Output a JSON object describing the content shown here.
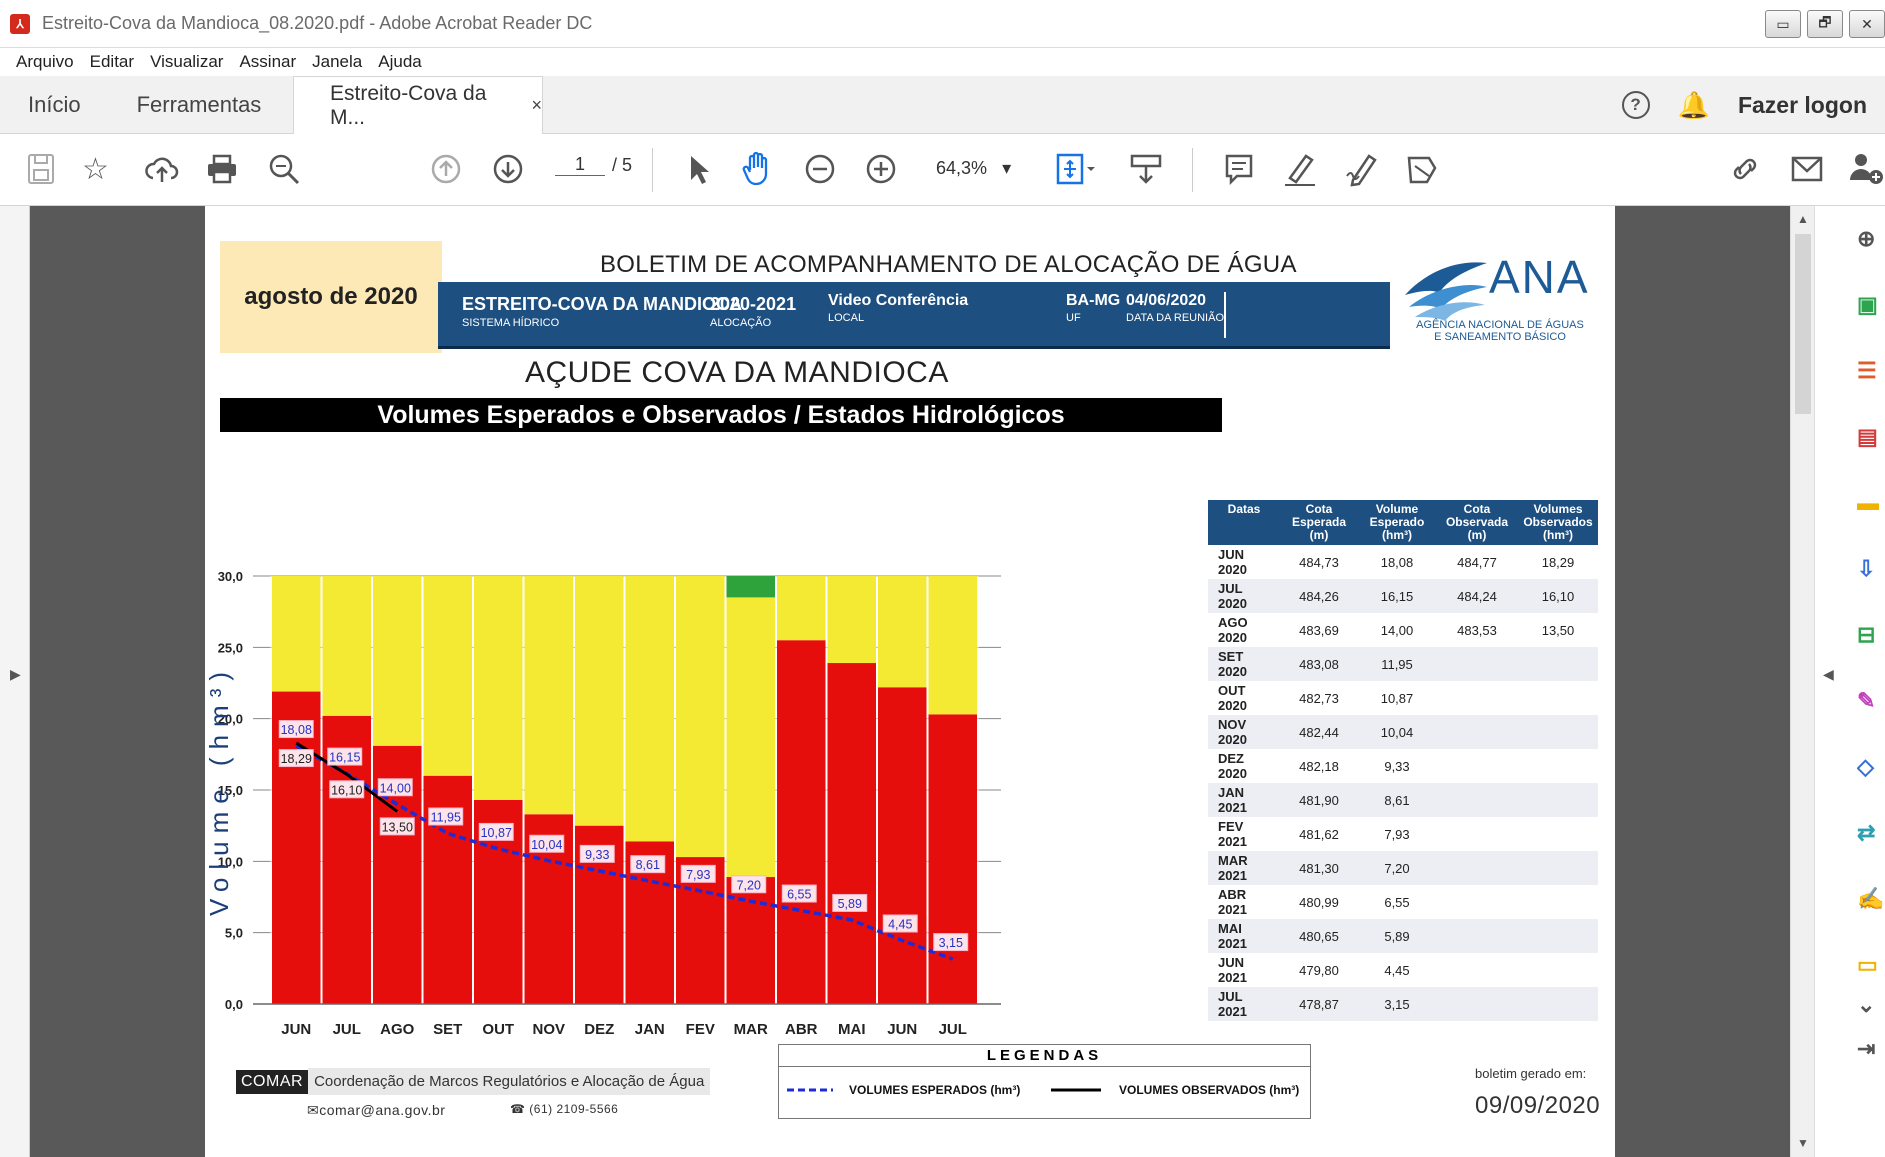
{
  "window": {
    "title": "Estreito-Cova da Mandioca_08.2020.pdf - Adobe Acrobat Reader DC",
    "buttons": [
      "▭",
      "🗗",
      "✕"
    ]
  },
  "menu": [
    "Arquivo",
    "Editar",
    "Visualizar",
    "Assinar",
    "Janela",
    "Ajuda"
  ],
  "tabs": {
    "home": "Início",
    "tools": "Ferramentas",
    "document": "Estreito-Cova da M...",
    "close": "×",
    "help": "?",
    "login": "Fazer logon"
  },
  "toolbar": {
    "page_current": "1",
    "page_total": "/ 5",
    "zoom": "64,3%",
    "icons": [
      "save-icon",
      "star-icon",
      "upload-icon",
      "print-icon",
      "search-zoom-icon",
      "page-up-icon",
      "page-down-icon",
      "pointer-icon",
      "hand-icon",
      "zoom-out-icon",
      "zoom-in-icon",
      "fit-page-icon",
      "scroll-mode-icon",
      "comment-icon",
      "highlight-icon",
      "sign-icon",
      "stamp-icon",
      "link-icon",
      "email-icon",
      "add-user-icon"
    ]
  },
  "right_panel": {
    "icons": [
      "zoom-icon",
      "export-pdf-icon",
      "organize-pages-icon",
      "create-pdf-icon",
      "comment-icon",
      "export-icon",
      "compress-icon",
      "fill-sign-icon",
      "protect-icon",
      "send-icon",
      "signature-icon",
      "more-tools-icon",
      "expand-icon",
      "collapse-panel-icon"
    ],
    "colors": [
      "#1a8ccc",
      "#2da44e",
      "#e05a2b",
      "#d43a3a",
      "#f0b400",
      "#3a6fd8",
      "#2da44e",
      "#c23fbe",
      "#3a6fd8",
      "#2aa0b0",
      "#c23fbe",
      "#f0b400"
    ]
  },
  "document": {
    "month_label": "agosto de 2020",
    "report_title": "BOLETIM DE ACOMPANHAMENTO DE ALOCAÇÃO DE ÁGUA",
    "header_fields": [
      {
        "value": "ESTREITO-COVA DA MANDIOCA",
        "label": "SISTEMA HÍDRICO"
      },
      {
        "value": "2020-2021",
        "label": "ALOCAÇÃO"
      },
      {
        "value": "Video Conferência",
        "label": "LOCAL"
      },
      {
        "value": "BA-MG",
        "label": "UF"
      },
      {
        "value": "04/06/2020",
        "label": "DATA DA REUNIÃO"
      }
    ],
    "agency": {
      "name": "ANA",
      "subtitle_line1": "AGÊNCIA NACIONAL DE ÁGUAS",
      "subtitle_line2": "E SANEAMENTO BÁSICO"
    },
    "reservoir_title": "AÇUDE COVA DA MANDIOCA",
    "chart_header": "Volumes Esperados e Observados / Estados Hidrológicos",
    "table": {
      "headers": [
        "Datas",
        "Cota Esperada (m)",
        "Volume Esperado (hm³)",
        "Cota Observada (m)",
        "Volumes Observados (hm³)"
      ],
      "rows": [
        [
          "JUN 2020",
          "484,73",
          "18,08",
          "484,77",
          "18,29"
        ],
        [
          "JUL 2020",
          "484,26",
          "16,15",
          "484,24",
          "16,10"
        ],
        [
          "AGO 2020",
          "483,69",
          "14,00",
          "483,53",
          "13,50"
        ],
        [
          "SET 2020",
          "483,08",
          "11,95",
          "",
          ""
        ],
        [
          "OUT 2020",
          "482,73",
          "10,87",
          "",
          ""
        ],
        [
          "NOV 2020",
          "482,44",
          "10,04",
          "",
          ""
        ],
        [
          "DEZ 2020",
          "482,18",
          "9,33",
          "",
          ""
        ],
        [
          "JAN 2021",
          "481,90",
          "8,61",
          "",
          ""
        ],
        [
          "FEV 2021",
          "481,62",
          "7,93",
          "",
          ""
        ],
        [
          "MAR 2021",
          "481,30",
          "7,20",
          "",
          ""
        ],
        [
          "ABR 2021",
          "480,99",
          "6,55",
          "",
          ""
        ],
        [
          "MAI 2021",
          "480,65",
          "5,89",
          "",
          ""
        ],
        [
          "JUN 2021",
          "479,80",
          "4,45",
          "",
          ""
        ],
        [
          "JUL 2021",
          "478,87",
          "3,15",
          "",
          ""
        ]
      ]
    },
    "footer": {
      "comar": "COMAR",
      "comar_desc": "Coordenação de Marcos Regulatórios e Alocação de Água",
      "email": "comar@ana.gov.br",
      "phone": "(61) 2109-5566",
      "legend_title": "LEGENDAS",
      "legend_expected": "VOLUMES ESPERADOS (hm³)",
      "legend_observed": "VOLUMES OBSERVADOS (hm³)",
      "generated_label": "boletim gerado em:",
      "generated_date": "09/09/2020"
    }
  },
  "chart_data": {
    "type": "bar",
    "ylabel": "Volume (hm³)",
    "ylim": [
      0,
      30
    ],
    "yticks": [
      "0,0",
      "5,0",
      "10,0",
      "15,0",
      "20,0",
      "25,0",
      "30,0"
    ],
    "categories": [
      [
        "JUN",
        "2020"
      ],
      [
        "JUL",
        "2020"
      ],
      [
        "AGO",
        "2020"
      ],
      [
        "SET",
        "2020"
      ],
      [
        "OUT",
        "2020"
      ],
      [
        "NOV",
        "2020"
      ],
      [
        "DEZ",
        "2020"
      ],
      [
        "JAN",
        "2021"
      ],
      [
        "FEV",
        "2021"
      ],
      [
        "MAR",
        "2021"
      ],
      [
        "ABR",
        "2021"
      ],
      [
        "MAI",
        "2021"
      ],
      [
        "JUN",
        "2021"
      ],
      [
        "JUL",
        "2021"
      ]
    ],
    "red_zone": [
      21.9,
      20.2,
      18.1,
      16.0,
      14.3,
      13.3,
      12.5,
      11.4,
      10.3,
      8.9,
      25.5,
      23.9,
      22.2,
      20.3
    ],
    "yellow_zone": [
      8.1,
      9.8,
      11.9,
      14.0,
      15.7,
      16.7,
      17.5,
      18.6,
      19.7,
      19.6,
      4.5,
      6.1,
      7.8,
      9.7
    ],
    "green_zone": [
      0,
      0,
      0,
      0,
      0,
      0,
      0,
      0,
      0,
      1.5,
      0,
      0,
      0,
      0
    ],
    "zone_colors": {
      "red": "#e60d0d",
      "yellow": "#f4e933",
      "green": "#2ea33b"
    },
    "series": [
      {
        "name": "VOLUMES ESPERADOS (hm³)",
        "style": "dashed",
        "color": "#1f2bd6",
        "values": [
          18.08,
          16.15,
          14.0,
          11.95,
          10.87,
          10.04,
          9.33,
          8.61,
          7.93,
          7.2,
          6.55,
          5.89,
          4.45,
          3.15
        ],
        "labels": [
          "18,08",
          "16,15",
          "14,00",
          "11,95",
          "10,87",
          "10,04",
          "9,33",
          "8,61",
          "7,93",
          "7,20",
          "6,55",
          "5,89",
          "4,45",
          "3,15"
        ]
      },
      {
        "name": "VOLUMES OBSERVADOS (hm³)",
        "style": "solid",
        "color": "#000000",
        "values": [
          18.29,
          16.1,
          13.5
        ],
        "labels": [
          "18,29",
          "16,10",
          "13,50"
        ]
      }
    ]
  }
}
